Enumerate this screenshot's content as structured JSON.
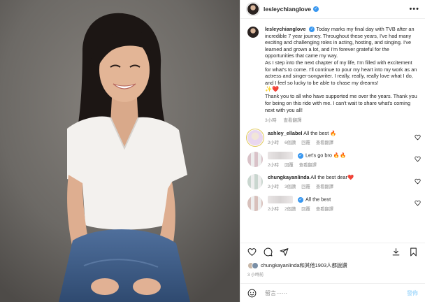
{
  "post": {
    "username": "lesleychianglove",
    "verified_mark": "✓",
    "more_glyph": "•••"
  },
  "caption": {
    "username": "lesleychianglove",
    "paragraph1": "Today marks my final day with TVB after an incredible 7 year journey. Throughout these years, I've had many exciting and challenging roles in acting, hosting, and singing. I've learned and grown a lot, and I'm forever grateful for the opportunities that came my way.",
    "paragraph2": "As I step into the next chapter of my life, I'm filled with excitement for what's to come. I'll continue to pour my heart into my work as an actress and singer-songwriter. I really, really, really love what I do, and I feel so lucky to be able to chase my dreams!",
    "emojis": "✨❤️",
    "paragraph3": "Thank you to all who have supported me over the years. Thank you for being on this ride with me. I can't wait to share what's coming next with you all!",
    "time": "3小時",
    "translate": "查看翻譯"
  },
  "comments": [
    {
      "username": "ashley_ellabel",
      "text": "All the best 🔥",
      "time": "2小時",
      "likes": "6個讚",
      "reply": "回覆",
      "translate": "查看翻譯",
      "avatar_color": "#e9d7f0",
      "blurred": false
    },
    {
      "username": "",
      "text": "Let's go bro 🔥🔥",
      "time": "2小時",
      "likes": "",
      "reply": "回覆",
      "translate": "查看翻譯",
      "avatar_color": "#d9c2c8",
      "blurred": true
    },
    {
      "username": "chungkayanlinda",
      "text": "All the best dear❤️",
      "time": "2小時",
      "likes": "3個讚",
      "reply": "回覆",
      "translate": "查看翻譯",
      "avatar_color": "#c9d6cf",
      "blurred": true
    },
    {
      "username": "",
      "text": "All the best",
      "time": "2小時",
      "likes": "2個讚",
      "reply": "回覆",
      "translate": "查看翻譯",
      "avatar_color": "#d8c0bb",
      "blurred": true
    }
  ],
  "likes_line": {
    "text": "chungkayanlinda和其他1903人都說讚"
  },
  "ago": "3 小時前",
  "compose": {
    "placeholder": "留言⋯⋯",
    "post_label": "發佈"
  },
  "icons": {
    "heart": "heart-icon",
    "comment": "comment-icon",
    "share": "share-icon",
    "save": "bookmark-icon",
    "download": "download-icon",
    "emoji": "emoji-icon"
  }
}
